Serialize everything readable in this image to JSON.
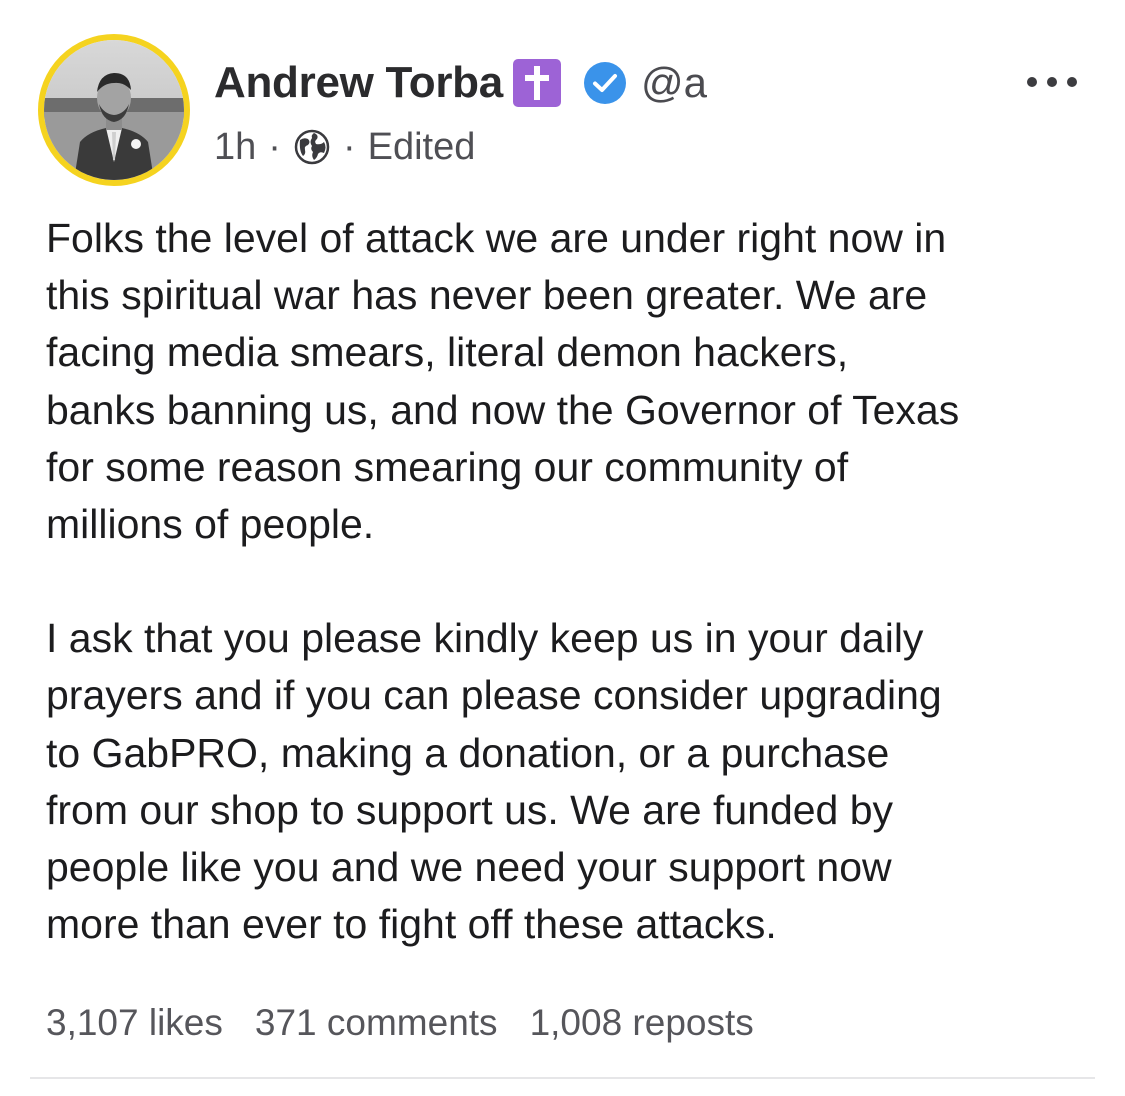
{
  "post": {
    "author": {
      "display_name": "Andrew Torba",
      "username": "@a",
      "badges": [
        "cross-icon",
        "verified-check-icon"
      ],
      "avatar_ring_color": "#f5d31f",
      "cross_badge_color": "#9d63d6",
      "verified_color": "#3a93ea"
    },
    "meta": {
      "time": "1h",
      "separator": "·",
      "visibility_icon": "globe-icon",
      "edited": "Edited"
    },
    "menu_icon": "more-dots-icon",
    "body": {
      "paragraph_1": [
        "Folks the level of attack we are under right now in",
        "this spiritual war has never been greater. We are",
        "facing media smears, literal demon hackers,",
        "banks banning us, and now the Governor of Texas",
        "for some reason smearing our community of",
        "millions of people."
      ],
      "paragraph_2": [
        "I ask that you please kindly keep us in your daily",
        "prayers and if you can please consider upgrading",
        "to GabPRO, making a donation, or a purchase",
        "from our shop to support us. We are funded by",
        "people like you and we need your support now",
        "more than ever to fight off these attacks."
      ]
    },
    "stats": {
      "likes": "3,107 likes",
      "comments": "371 comments",
      "reposts": "1,008 reposts"
    }
  }
}
